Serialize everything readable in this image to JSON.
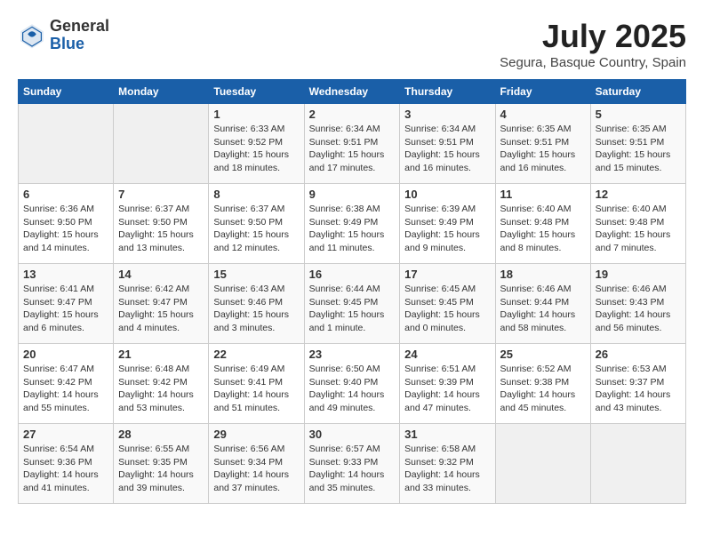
{
  "header": {
    "logo_general": "General",
    "logo_blue": "Blue",
    "title": "July 2025",
    "location": "Segura, Basque Country, Spain"
  },
  "days_of_week": [
    "Sunday",
    "Monday",
    "Tuesday",
    "Wednesday",
    "Thursday",
    "Friday",
    "Saturday"
  ],
  "weeks": [
    [
      {
        "day": "",
        "info": ""
      },
      {
        "day": "",
        "info": ""
      },
      {
        "day": "1",
        "info": "Sunrise: 6:33 AM\nSunset: 9:52 PM\nDaylight: 15 hours\nand 18 minutes."
      },
      {
        "day": "2",
        "info": "Sunrise: 6:34 AM\nSunset: 9:51 PM\nDaylight: 15 hours\nand 17 minutes."
      },
      {
        "day": "3",
        "info": "Sunrise: 6:34 AM\nSunset: 9:51 PM\nDaylight: 15 hours\nand 16 minutes."
      },
      {
        "day": "4",
        "info": "Sunrise: 6:35 AM\nSunset: 9:51 PM\nDaylight: 15 hours\nand 16 minutes."
      },
      {
        "day": "5",
        "info": "Sunrise: 6:35 AM\nSunset: 9:51 PM\nDaylight: 15 hours\nand 15 minutes."
      }
    ],
    [
      {
        "day": "6",
        "info": "Sunrise: 6:36 AM\nSunset: 9:50 PM\nDaylight: 15 hours\nand 14 minutes."
      },
      {
        "day": "7",
        "info": "Sunrise: 6:37 AM\nSunset: 9:50 PM\nDaylight: 15 hours\nand 13 minutes."
      },
      {
        "day": "8",
        "info": "Sunrise: 6:37 AM\nSunset: 9:50 PM\nDaylight: 15 hours\nand 12 minutes."
      },
      {
        "day": "9",
        "info": "Sunrise: 6:38 AM\nSunset: 9:49 PM\nDaylight: 15 hours\nand 11 minutes."
      },
      {
        "day": "10",
        "info": "Sunrise: 6:39 AM\nSunset: 9:49 PM\nDaylight: 15 hours\nand 9 minutes."
      },
      {
        "day": "11",
        "info": "Sunrise: 6:40 AM\nSunset: 9:48 PM\nDaylight: 15 hours\nand 8 minutes."
      },
      {
        "day": "12",
        "info": "Sunrise: 6:40 AM\nSunset: 9:48 PM\nDaylight: 15 hours\nand 7 minutes."
      }
    ],
    [
      {
        "day": "13",
        "info": "Sunrise: 6:41 AM\nSunset: 9:47 PM\nDaylight: 15 hours\nand 6 minutes."
      },
      {
        "day": "14",
        "info": "Sunrise: 6:42 AM\nSunset: 9:47 PM\nDaylight: 15 hours\nand 4 minutes."
      },
      {
        "day": "15",
        "info": "Sunrise: 6:43 AM\nSunset: 9:46 PM\nDaylight: 15 hours\nand 3 minutes."
      },
      {
        "day": "16",
        "info": "Sunrise: 6:44 AM\nSunset: 9:45 PM\nDaylight: 15 hours\nand 1 minute."
      },
      {
        "day": "17",
        "info": "Sunrise: 6:45 AM\nSunset: 9:45 PM\nDaylight: 15 hours\nand 0 minutes."
      },
      {
        "day": "18",
        "info": "Sunrise: 6:46 AM\nSunset: 9:44 PM\nDaylight: 14 hours\nand 58 minutes."
      },
      {
        "day": "19",
        "info": "Sunrise: 6:46 AM\nSunset: 9:43 PM\nDaylight: 14 hours\nand 56 minutes."
      }
    ],
    [
      {
        "day": "20",
        "info": "Sunrise: 6:47 AM\nSunset: 9:42 PM\nDaylight: 14 hours\nand 55 minutes."
      },
      {
        "day": "21",
        "info": "Sunrise: 6:48 AM\nSunset: 9:42 PM\nDaylight: 14 hours\nand 53 minutes."
      },
      {
        "day": "22",
        "info": "Sunrise: 6:49 AM\nSunset: 9:41 PM\nDaylight: 14 hours\nand 51 minutes."
      },
      {
        "day": "23",
        "info": "Sunrise: 6:50 AM\nSunset: 9:40 PM\nDaylight: 14 hours\nand 49 minutes."
      },
      {
        "day": "24",
        "info": "Sunrise: 6:51 AM\nSunset: 9:39 PM\nDaylight: 14 hours\nand 47 minutes."
      },
      {
        "day": "25",
        "info": "Sunrise: 6:52 AM\nSunset: 9:38 PM\nDaylight: 14 hours\nand 45 minutes."
      },
      {
        "day": "26",
        "info": "Sunrise: 6:53 AM\nSunset: 9:37 PM\nDaylight: 14 hours\nand 43 minutes."
      }
    ],
    [
      {
        "day": "27",
        "info": "Sunrise: 6:54 AM\nSunset: 9:36 PM\nDaylight: 14 hours\nand 41 minutes."
      },
      {
        "day": "28",
        "info": "Sunrise: 6:55 AM\nSunset: 9:35 PM\nDaylight: 14 hours\nand 39 minutes."
      },
      {
        "day": "29",
        "info": "Sunrise: 6:56 AM\nSunset: 9:34 PM\nDaylight: 14 hours\nand 37 minutes."
      },
      {
        "day": "30",
        "info": "Sunrise: 6:57 AM\nSunset: 9:33 PM\nDaylight: 14 hours\nand 35 minutes."
      },
      {
        "day": "31",
        "info": "Sunrise: 6:58 AM\nSunset: 9:32 PM\nDaylight: 14 hours\nand 33 minutes."
      },
      {
        "day": "",
        "info": ""
      },
      {
        "day": "",
        "info": ""
      }
    ]
  ]
}
